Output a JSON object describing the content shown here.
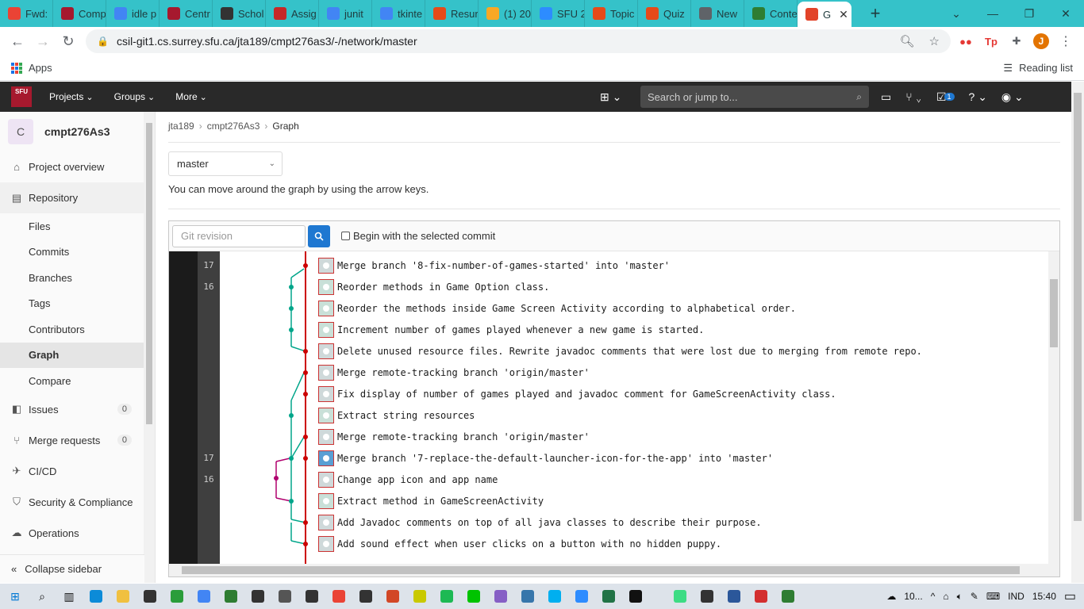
{
  "browser": {
    "tabs": [
      {
        "label": "Fwd:",
        "icon": "gmail-icon",
        "color": "#ea4335"
      },
      {
        "label": "Comp",
        "icon": "sfu-icon",
        "color": "#a6192e"
      },
      {
        "label": "idle p",
        "icon": "google-icon",
        "color": "#4285f4"
      },
      {
        "label": "Centr",
        "icon": "sfu-icon",
        "color": "#a6192e"
      },
      {
        "label": "Schol",
        "icon": "puzzle-icon",
        "color": "#333333"
      },
      {
        "label": "Assig",
        "icon": "course-276-icon",
        "color": "#c62828"
      },
      {
        "label": "junit",
        "icon": "google-icon",
        "color": "#4285f4"
      },
      {
        "label": "tkinte",
        "icon": "google-icon",
        "color": "#4285f4"
      },
      {
        "label": "Resur",
        "icon": "circle-icon",
        "color": "#e64a19"
      },
      {
        "label": "(1) 20",
        "icon": "moon-icon",
        "color": "#f9a825"
      },
      {
        "label": "SFU 2",
        "icon": "zoom-icon",
        "color": "#2d8cff"
      },
      {
        "label": "Topic",
        "icon": "circle-icon",
        "color": "#e64a19"
      },
      {
        "label": "Quiz",
        "icon": "circle-icon",
        "color": "#e64a19"
      },
      {
        "label": "New",
        "icon": "chrome-icon",
        "color": "#5f6368"
      },
      {
        "label": "Conte",
        "icon": "cloud-icon",
        "color": "#2e7d32"
      },
      {
        "label": "G",
        "icon": "gitlab-icon",
        "color": "#e24329",
        "active": true
      }
    ],
    "url": "csil-git1.cs.surrey.sfu.ca/jta189/cmpt276as3/-/network/master",
    "bookmarks": {
      "apps": "Apps",
      "reading_list": "Reading list"
    },
    "profile_initial": "J"
  },
  "gitlab": {
    "logo_text": "SFU",
    "menu": [
      "Projects",
      "Groups",
      "More"
    ],
    "search_placeholder": "Search or jump to...",
    "todo_count": "1"
  },
  "sidebar": {
    "project_initial": "C",
    "project_name": "cmpt276As3",
    "project_overview": "Project overview",
    "repository": "Repository",
    "repo_items": [
      "Files",
      "Commits",
      "Branches",
      "Tags",
      "Contributors",
      "Graph",
      "Compare"
    ],
    "active_item": "Graph",
    "issues": "Issues",
    "issues_count": "0",
    "merge_requests": "Merge requests",
    "merge_requests_count": "0",
    "cicd": "CI/CD",
    "security": "Security & Compliance",
    "operations": "Operations",
    "collapse": "Collapse sidebar"
  },
  "main": {
    "breadcrumb": [
      "jta189",
      "cmpt276As3",
      "Graph"
    ],
    "branch": "master",
    "hint": "You can move around the graph by using the arrow keys.",
    "revision_placeholder": "Git revision",
    "begin_selected": "Begin with the selected commit",
    "commits": [
      {
        "day": "17",
        "message": "Merge branch '8-fix-number-of-games-started' into 'master'",
        "avatar": "default"
      },
      {
        "day": "16",
        "message": "Reorder methods in Game Option class.",
        "avatar": "teal"
      },
      {
        "day": "",
        "message": "Reorder the methods inside Game Screen Activity according to alphabetical order.",
        "avatar": "teal"
      },
      {
        "day": "",
        "message": "Increment number of games played whenever a new game is started.",
        "avatar": "teal"
      },
      {
        "day": "",
        "message": "Delete unused resource files. Rewrite javadoc comments that were lost due to merging from remote repo.",
        "avatar": "default"
      },
      {
        "day": "",
        "message": "Merge remote-tracking branch 'origin/master'",
        "avatar": "default"
      },
      {
        "day": "",
        "message": "Fix display of number of games played and javadoc comment for GameScreenActivity class.",
        "avatar": "default"
      },
      {
        "day": "",
        "message": "Extract string resources",
        "avatar": "teal"
      },
      {
        "day": "",
        "message": "Merge remote-tracking branch 'origin/master'",
        "avatar": "default"
      },
      {
        "day": "17",
        "message": "Merge branch '7-replace-the-default-launcher-icon-for-the-app' into 'master'",
        "avatar": "special"
      },
      {
        "day": "16",
        "message": "Change app icon and app name",
        "avatar": "default"
      },
      {
        "day": "",
        "message": "Extract method in GameScreenActivity",
        "avatar": "teal"
      },
      {
        "day": "",
        "message": "Add Javadoc comments on top of all java classes to describe their purpose.",
        "avatar": "default"
      },
      {
        "day": "",
        "message": "Add sound effect when user clicks on a button with no hidden puppy.",
        "avatar": "default"
      }
    ]
  },
  "taskbar": {
    "weather": "10...",
    "lang": "IND",
    "time": "15:40"
  },
  "colors": {
    "master_line": "#cc0000",
    "branch_teal": "#00a58a",
    "branch_magenta": "#b0006e",
    "gitlab_nav": "#292929",
    "chrome_tabstrip": "#35c2c9",
    "search_button": "#1f78d1"
  }
}
